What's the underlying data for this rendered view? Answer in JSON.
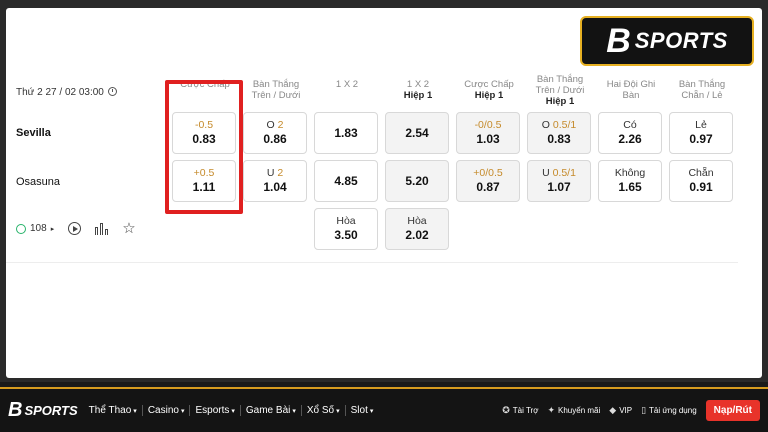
{
  "match": {
    "datetime": "Thứ 2 27 / 02 03:00",
    "home_team": "Sevilla",
    "away_team": "Osasuna",
    "bet_count": "108"
  },
  "columns": [
    {
      "title": "Cược Chấp",
      "sub": ""
    },
    {
      "title": "Bàn Thắng Trên / Dưới",
      "sub": ""
    },
    {
      "title": "1 X 2",
      "sub": ""
    },
    {
      "title": "1 X 2",
      "sub": "Hiệp 1"
    },
    {
      "title": "Cược Chấp",
      "sub": "Hiệp 1"
    },
    {
      "title": "Bàn Thắng Trên / Dưới",
      "sub": "Hiệp 1"
    },
    {
      "title": "Hai Đội Ghi Bàn",
      "sub": ""
    },
    {
      "title": "Bàn Thắng Chẵn / Lẻ",
      "sub": ""
    }
  ],
  "odds": {
    "handicap": {
      "home_line": "-0.5",
      "home_odds": "0.83",
      "away_line": "+0.5",
      "away_odds": "1.11"
    },
    "over_under": {
      "home_prefix": "O",
      "home_line": "2",
      "home_odds": "0.86",
      "away_prefix": "U",
      "away_line": "2",
      "away_odds": "1.04"
    },
    "one_x_two": {
      "home": "1.83",
      "away": "4.85",
      "draw_label": "Hòa",
      "draw": "3.50"
    },
    "one_x_two_h1": {
      "home": "2.54",
      "away": "5.20",
      "draw_label": "Hòa",
      "draw": "2.02"
    },
    "handicap_h1": {
      "home_line": "-0/0.5",
      "home_odds": "1.03",
      "away_line": "+0/0.5",
      "away_odds": "0.87"
    },
    "over_under_h1": {
      "home_prefix": "O",
      "home_line": "0.5/1",
      "home_odds": "0.83",
      "away_prefix": "U",
      "away_line": "0.5/1",
      "away_odds": "1.07"
    },
    "btts": {
      "home_label": "Có",
      "home_odds": "2.26",
      "away_label": "Không",
      "away_odds": "1.65"
    },
    "odd_even": {
      "home_label": "Lẻ",
      "home_odds": "0.97",
      "away_label": "Chẵn",
      "away_odds": "0.91"
    }
  },
  "brand": {
    "logo_letter": "B",
    "logo_text": "SPORTS"
  },
  "nav": {
    "items": [
      "Thể Thao",
      "Casino",
      "Esports",
      "Game Bài",
      "Xổ Số",
      "Slot"
    ],
    "right": [
      "Tài Trợ",
      "Khuyến mãi",
      "VIP",
      "Tải ứng dụng"
    ],
    "cta": "Nạp/Rút"
  },
  "colors": {
    "highlight": "#e02020",
    "accent_gold": "#d79c1f",
    "line_orange": "#c58a2a",
    "cta_red": "#e8332a"
  },
  "icons": [
    "clock-icon",
    "count-icon",
    "play-icon",
    "stats-icon",
    "star-icon"
  ]
}
